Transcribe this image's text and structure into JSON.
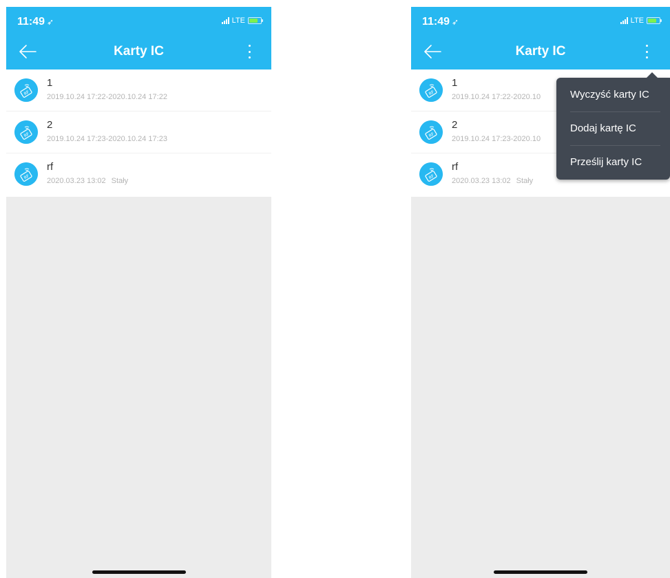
{
  "status_bar": {
    "time": "11:49",
    "location_glyph": "➶",
    "network": "LTE"
  },
  "nav": {
    "title": "Karty IC",
    "back_glyph": "←"
  },
  "cards": [
    {
      "name": "1",
      "date": "2019.10.24 17:22-2020.10.24 17:22",
      "date_truncated": "2019.10.24 17:22-2020.10",
      "permanent": ""
    },
    {
      "name": "2",
      "date": "2019.10.24 17:23-2020.10.24 17:23",
      "date_truncated": "2019.10.24 17:23-2020.10",
      "permanent": ""
    },
    {
      "name": "rf",
      "date": "2020.03.23 13:02",
      "date_truncated": "2020.03.23 13:02",
      "permanent": "Stały"
    }
  ],
  "menu": {
    "items": [
      {
        "label": "Wyczyść karty IC"
      },
      {
        "label": "Dodaj kartę IC"
      },
      {
        "label": "Prześlij karty IC"
      }
    ]
  },
  "icons": {
    "card": "ic-card-rfid-icon",
    "more": "more-vertical-icon",
    "back": "back-arrow-icon"
  },
  "colors": {
    "accent": "#27b8f1",
    "menu_bg": "#414852",
    "background": "#ececec",
    "secondary_text": "#b4b4b4"
  }
}
